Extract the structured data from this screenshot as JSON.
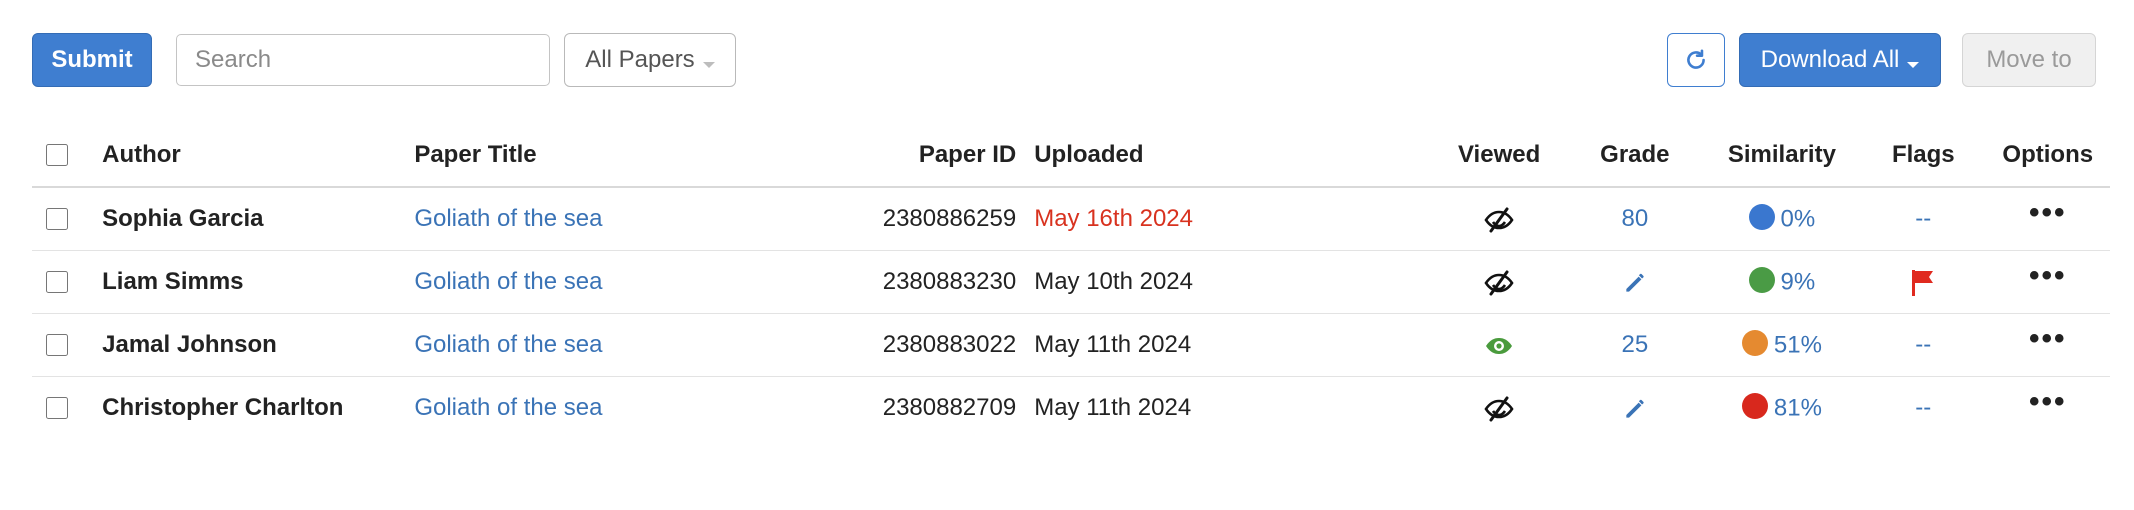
{
  "toolbar": {
    "submit_label": "Submit",
    "search_placeholder": "Search",
    "filter_label": "All Papers",
    "download_label": "Download All",
    "move_label": "Move to"
  },
  "colors": {
    "primary": "#3f7ed0",
    "link": "#3a73b6",
    "overdue": "#d8321f",
    "viewed": "#4a9b3d",
    "flag": "#e02a1f"
  },
  "table": {
    "headers": {
      "author": "Author",
      "title": "Paper Title",
      "paper_id": "Paper ID",
      "uploaded": "Uploaded",
      "viewed": "Viewed",
      "grade": "Grade",
      "similarity": "Similarity",
      "flags": "Flags",
      "options": "Options"
    },
    "rows": [
      {
        "author": "Sophia Garcia",
        "title": "Goliath of the sea",
        "paper_id": "2380886259",
        "uploaded": "May 16th 2024",
        "uploaded_late": true,
        "viewed": false,
        "grade": "80",
        "similarity": "0%",
        "similarity_color": "#3a77cf",
        "flags": "--",
        "flagged": false,
        "options": "•••"
      },
      {
        "author": "Liam Simms",
        "title": "Goliath of the sea",
        "paper_id": "2380883230",
        "uploaded": "May 10th 2024",
        "uploaded_late": false,
        "viewed": false,
        "grade": "",
        "grade_icon": "pencil-icon",
        "similarity": "9%",
        "similarity_color": "#4a9b45",
        "flags": "",
        "flagged": true,
        "options": "•••"
      },
      {
        "author": "Jamal Johnson",
        "title": "Goliath of the sea",
        "paper_id": "2380883022",
        "uploaded": "May 11th 2024",
        "uploaded_late": false,
        "viewed": true,
        "grade": "25",
        "similarity": "51%",
        "similarity_color": "#e58a30",
        "flags": "--",
        "flagged": false,
        "options": "•••"
      },
      {
        "author": "Christopher Charlton",
        "title": "Goliath of the sea",
        "paper_id": "2380882709",
        "uploaded": "May 11th 2024",
        "uploaded_late": false,
        "viewed": false,
        "grade": "",
        "grade_icon": "pencil-icon",
        "similarity": "81%",
        "similarity_color": "#d8281d",
        "flags": "--",
        "flagged": false,
        "options": "•••"
      }
    ]
  }
}
